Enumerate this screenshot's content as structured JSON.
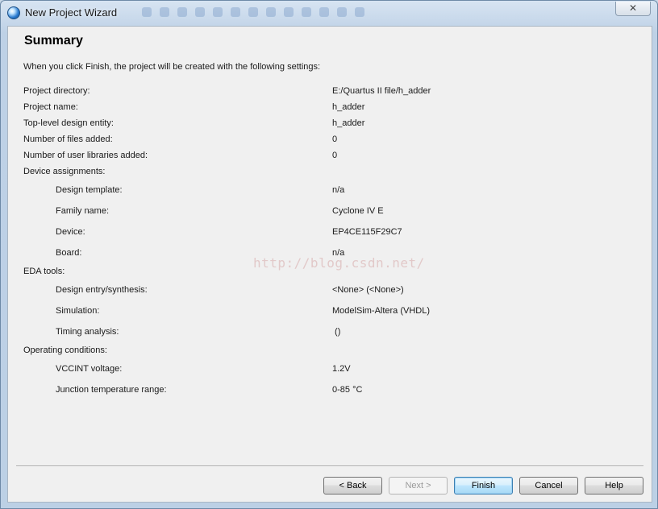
{
  "window": {
    "title": "New Project Wizard",
    "close_glyph": "✕"
  },
  "summary": {
    "heading": "Summary",
    "intro": "When you click Finish, the project will be created with the following settings:",
    "rows": [
      {
        "label": "Project directory:",
        "value": "E:/Quartus II file/h_adder"
      },
      {
        "label": "Project name:",
        "value": "h_adder"
      },
      {
        "label": "Top-level design entity:",
        "value": "h_adder"
      },
      {
        "label": "Number of files added:",
        "value": "0"
      },
      {
        "label": "Number of user libraries added:",
        "value": "0"
      },
      {
        "label": "Device assignments:",
        "value": ""
      },
      {
        "label": "Design template:",
        "value": "n/a"
      },
      {
        "label": "Family name:",
        "value": "Cyclone IV E"
      },
      {
        "label": "Device:",
        "value": "EP4CE115F29C7"
      },
      {
        "label": "Board:",
        "value": "n/a"
      },
      {
        "label": "EDA tools:",
        "value": ""
      },
      {
        "label": "Design entry/synthesis:",
        "value": "<None> (<None>)"
      },
      {
        "label": "Simulation:",
        "value": "ModelSim-Altera (VHDL)"
      },
      {
        "label": "Timing analysis:",
        "value": " ()"
      },
      {
        "label": "Operating conditions:",
        "value": ""
      },
      {
        "label": "VCCINT voltage:",
        "value": "1.2V"
      },
      {
        "label": "Junction temperature range:",
        "value": "0-85 °C"
      }
    ]
  },
  "watermark": "http://blog.csdn.net/",
  "buttons": {
    "back": "< Back",
    "next": "Next >",
    "finish": "Finish",
    "cancel": "Cancel",
    "help": "Help"
  }
}
